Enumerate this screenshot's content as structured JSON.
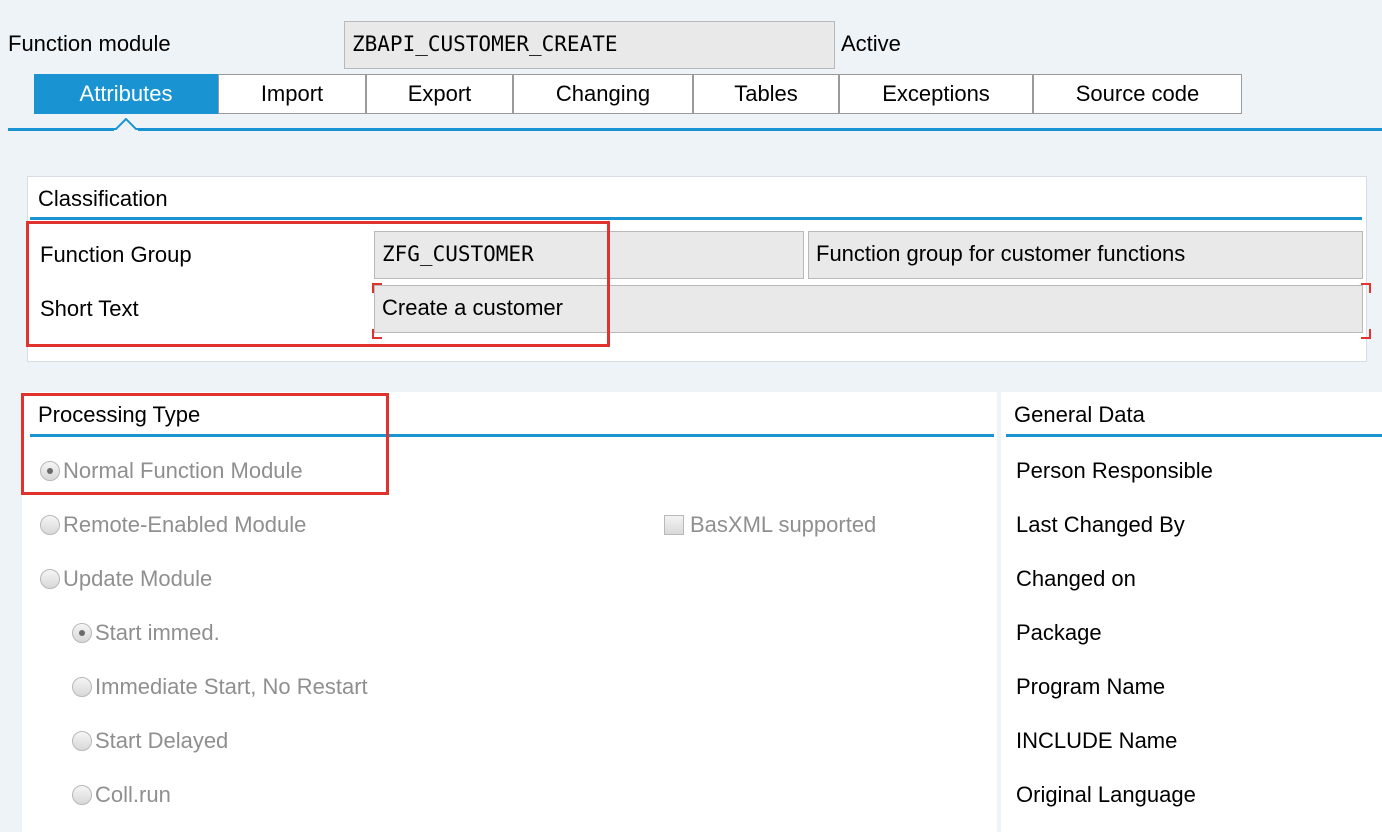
{
  "header": {
    "label": "Function module",
    "name": "ZBAPI_CUSTOMER_CREATE",
    "status": "Active"
  },
  "tabs": [
    {
      "label": "Attributes",
      "active": true
    },
    {
      "label": "Import",
      "active": false
    },
    {
      "label": "Export",
      "active": false
    },
    {
      "label": "Changing",
      "active": false
    },
    {
      "label": "Tables",
      "active": false
    },
    {
      "label": "Exceptions",
      "active": false
    },
    {
      "label": "Source code",
      "active": false
    }
  ],
  "classification": {
    "title": "Classification",
    "function_group_label": "Function Group",
    "function_group_value": "ZFG_CUSTOMER",
    "function_group_desc": "Function group for customer functions",
    "short_text_label": "Short Text",
    "short_text_value": "Create a customer"
  },
  "processing_type": {
    "title": "Processing Type",
    "options": [
      {
        "label": "Normal Function Module",
        "selected": true
      },
      {
        "label": "Remote-Enabled Module",
        "selected": false
      },
      {
        "label": "Update Module",
        "selected": false
      }
    ],
    "basxml_label": "BasXML supported",
    "update_options": [
      {
        "label": "Start immed.",
        "selected": true
      },
      {
        "label": "Immediate Start, No Restart",
        "selected": false
      },
      {
        "label": "Start Delayed",
        "selected": false
      },
      {
        "label": "Coll.run",
        "selected": false
      }
    ]
  },
  "general_data": {
    "title": "General Data",
    "fields": [
      "Person Responsible",
      "Last Changed By",
      "Changed on",
      "Package",
      "Program Name",
      "INCLUDE Name",
      "Original Language"
    ]
  },
  "colors": {
    "accent": "#1a93d3",
    "highlight": "#e0332d",
    "field_bg": "#e9e9e9"
  }
}
